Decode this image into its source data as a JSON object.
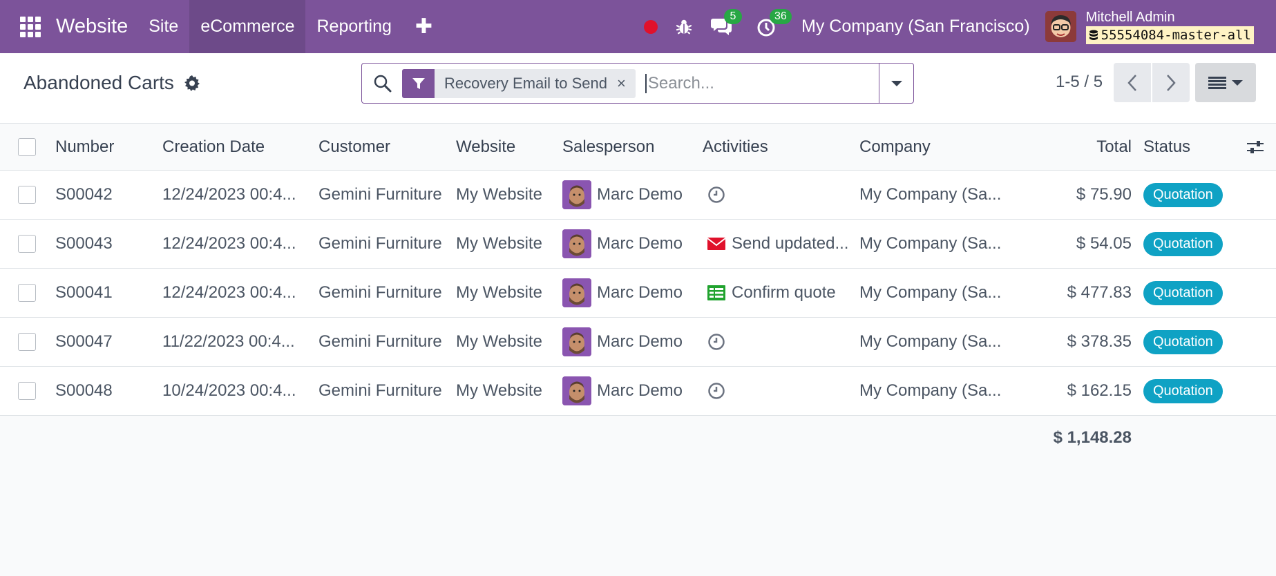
{
  "navbar": {
    "brand": "Website",
    "menu": [
      "Site",
      "eCommerce",
      "Reporting"
    ],
    "active_menu": "eCommerce",
    "messages_count": "5",
    "activities_count": "36",
    "company": "My Company (San Francisco)",
    "user_name": "Mitchell Admin",
    "database": "55554084-master-all",
    "colors": {
      "navbar": "#7c539a",
      "badge": "#28a745",
      "record": "#e0112b"
    }
  },
  "control": {
    "title": "Abandoned Carts",
    "facet_label": "Recovery Email to Send",
    "search_placeholder": "Search...",
    "pager": "1-5 / 5"
  },
  "table": {
    "columns": {
      "number": "Number",
      "date": "Creation Date",
      "customer": "Customer",
      "website": "Website",
      "salesperson": "Salesperson",
      "activities": "Activities",
      "company": "Company",
      "total": "Total",
      "status": "Status"
    },
    "rows": [
      {
        "number": "S00042",
        "date": "12/24/2023 00:4...",
        "customer": "Gemini Furniture",
        "website": "My Website",
        "salesperson": "Marc Demo",
        "activity_icon": "clock-icon",
        "activity_text": "",
        "company": "My Company (Sa...",
        "total": "$ 75.90",
        "status": "Quotation"
      },
      {
        "number": "S00043",
        "date": "12/24/2023 00:4...",
        "customer": "Gemini Furniture",
        "website": "My Website",
        "salesperson": "Marc Demo",
        "activity_icon": "envelope-icon",
        "activity_text": "Send updated...",
        "company": "My Company (Sa...",
        "total": "$ 54.05",
        "status": "Quotation"
      },
      {
        "number": "S00041",
        "date": "12/24/2023 00:4...",
        "customer": "Gemini Furniture",
        "website": "My Website",
        "salesperson": "Marc Demo",
        "activity_icon": "tasks-icon",
        "activity_text": "Confirm quote",
        "company": "My Company (Sa...",
        "total": "$ 477.83",
        "status": "Quotation"
      },
      {
        "number": "S00047",
        "date": "11/22/2023 00:4...",
        "customer": "Gemini Furniture",
        "website": "My Website",
        "salesperson": "Marc Demo",
        "activity_icon": "clock-icon",
        "activity_text": "",
        "company": "My Company (Sa...",
        "total": "$ 378.35",
        "status": "Quotation"
      },
      {
        "number": "S00048",
        "date": "10/24/2023 00:4...",
        "customer": "Gemini Furniture",
        "website": "My Website",
        "salesperson": "Marc Demo",
        "activity_icon": "clock-icon",
        "activity_text": "",
        "company": "My Company (Sa...",
        "total": "$ 162.15",
        "status": "Quotation"
      }
    ],
    "grand_total": "$ 1,148.28",
    "colors": {
      "status_badge": "#0fa2c4",
      "email_activity": "#e0112b",
      "todo_activity": "#21a32f"
    }
  }
}
